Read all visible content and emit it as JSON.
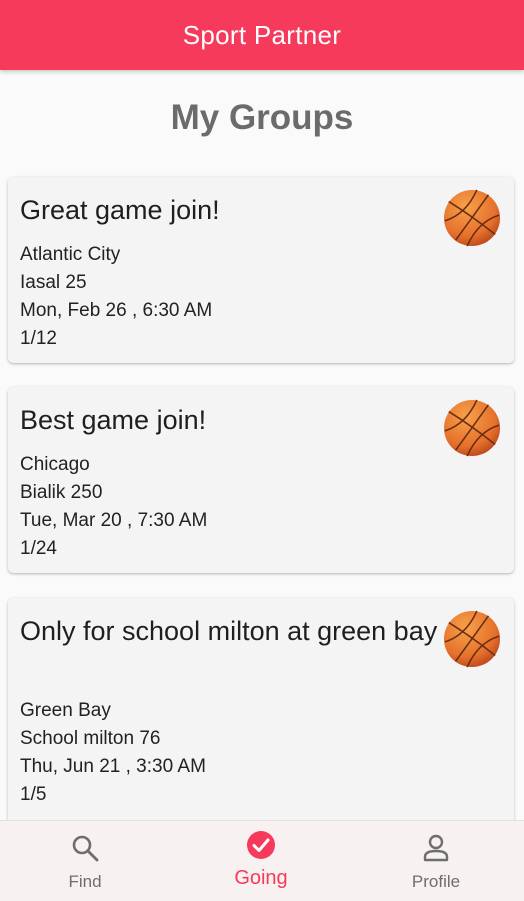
{
  "app": {
    "title": "Sport Partner"
  },
  "page": {
    "title": "My Groups"
  },
  "groups": [
    {
      "title": "Great game join!",
      "city": "Atlantic City",
      "address": "Iasal 25",
      "datetime": "Mon, Feb 26 , 6:30 AM",
      "participants": "1/12",
      "sport_icon": "basketball-icon"
    },
    {
      "title": "Best game join!",
      "city": "Chicago",
      "address": "Bialik 250",
      "datetime": "Tue, Mar 20 , 7:30 AM",
      "participants": "1/24",
      "sport_icon": "basketball-icon"
    },
    {
      "title": "Only for school milton at green bay",
      "city": "Green Bay",
      "address": "School milton 76",
      "datetime": "Thu, Jun 21 , 3:30 AM",
      "participants": "1/5",
      "sport_icon": "basketball-icon"
    }
  ],
  "nav": {
    "items": [
      {
        "label": "Find",
        "icon": "search-icon",
        "active": false
      },
      {
        "label": "Going",
        "icon": "check-circle-icon",
        "active": true
      },
      {
        "label": "Profile",
        "icon": "person-icon",
        "active": false
      }
    ]
  },
  "colors": {
    "primary": "#f53a5c",
    "card": "#f4f4f4",
    "ball": "#e8712e"
  }
}
